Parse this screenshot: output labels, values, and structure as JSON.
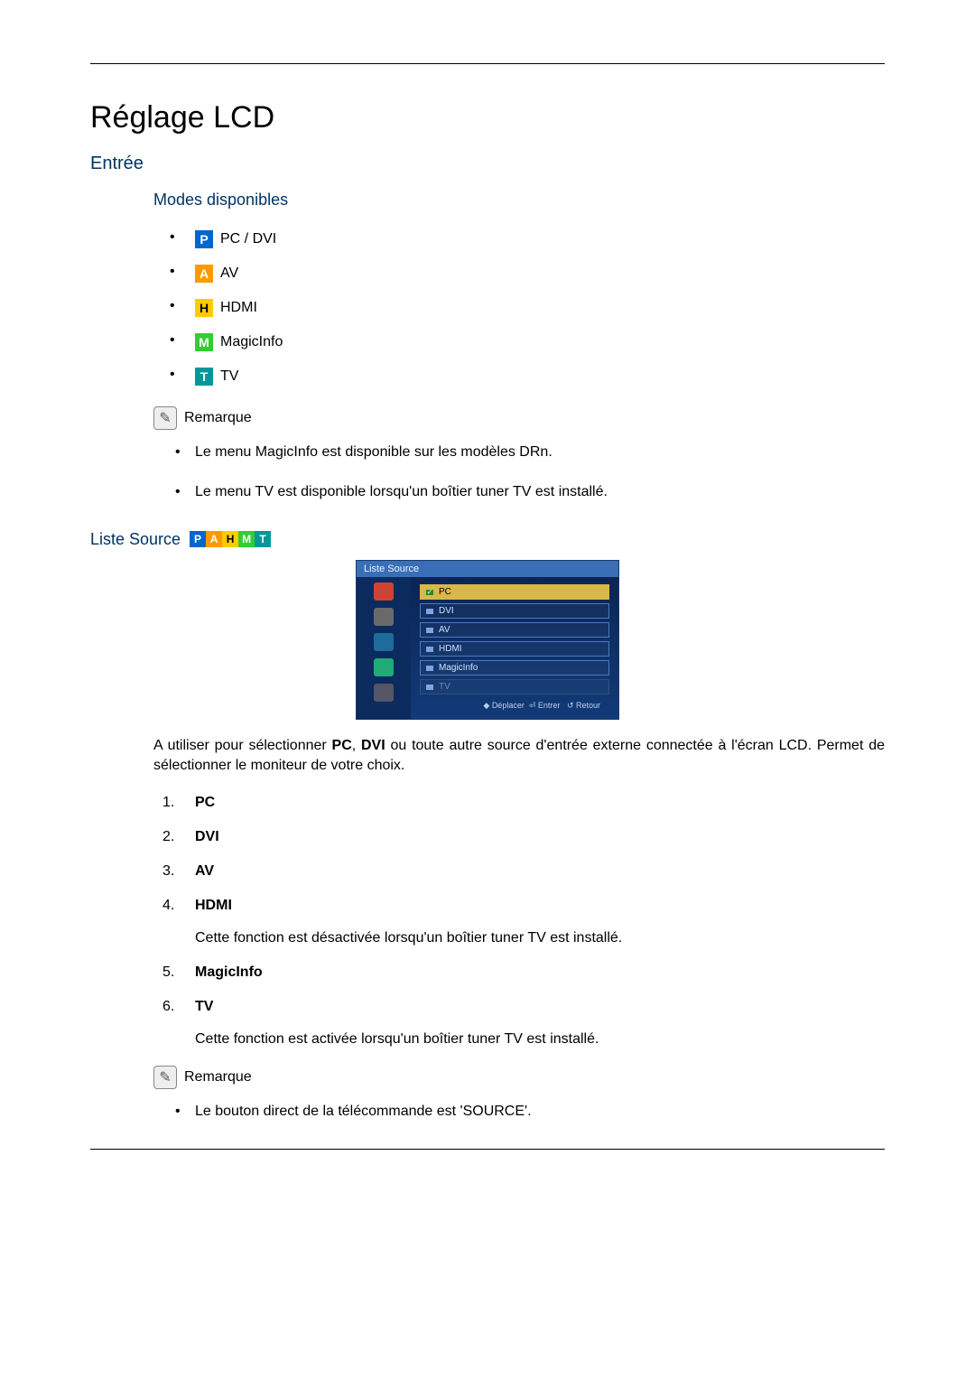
{
  "title": "Réglage LCD",
  "section_entree": "Entrée",
  "section_modes": "Modes disponibles",
  "modes": {
    "pc_dvi": {
      "badge": "P",
      "label": "PC / DVI"
    },
    "av": {
      "badge": "A",
      "label": "AV"
    },
    "hdmi": {
      "badge": "H",
      "label": "HDMI"
    },
    "magic": {
      "badge": "M",
      "label": "MagicInfo"
    },
    "tv": {
      "badge": "T",
      "label": "TV"
    }
  },
  "remarque_label": "Remarque",
  "remarque1_items": [
    "Le menu MagicInfo est disponible sur les modèles DRn.",
    "Le menu TV est disponible lorsqu'un boîtier tuner TV est installé."
  ],
  "liste_source_title": "Liste Source",
  "badges_strip": [
    "P",
    "A",
    "H",
    "M",
    "T"
  ],
  "osd": {
    "title": "Liste Source",
    "items": [
      "PC",
      "DVI",
      "AV",
      "HDMI",
      "MagicInfo",
      "TV"
    ],
    "footer_move": "Déplacer",
    "footer_enter": "Entrer",
    "footer_return": "Retour"
  },
  "liste_source_desc_prefix": "A utiliser pour sélectionner ",
  "liste_source_desc_pc": "PC",
  "liste_source_desc_sep": ", ",
  "liste_source_desc_dvi": "DVI",
  "liste_source_desc_suffix": " ou toute autre source d'entrée externe connectée à l'écran LCD. Permet de sélectionner le moniteur de votre choix.",
  "numbered": {
    "pc": "PC",
    "dvi": "DVI",
    "av": "AV",
    "hdmi": "HDMI",
    "hdmi_note": "Cette fonction est désactivée lorsqu'un boîtier tuner TV est installé.",
    "magic": "MagicInfo",
    "tv": "TV",
    "tv_note": "Cette fonction est activée lorsqu'un boîtier tuner TV est installé."
  },
  "remarque2_items": [
    "Le bouton direct de la télécommande est 'SOURCE'."
  ]
}
